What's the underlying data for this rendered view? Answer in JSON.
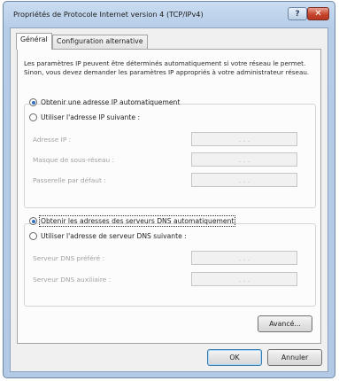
{
  "window": {
    "title": "Propriétés de Protocole Internet version 4 (TCP/IPv4)",
    "help_label": "?",
    "close_label": "✕"
  },
  "tabs": [
    {
      "label": "Général",
      "active": true
    },
    {
      "label": "Configuration alternative",
      "active": false
    }
  ],
  "general": {
    "description": "Les paramètres IP peuvent être déterminés automatiquement si votre réseau le permet. Sinon, vous devez demander les paramètres IP appropriés à votre administrateur réseau.",
    "ip_auto_label": "Obtenir une adresse IP automatiquement",
    "ip_manual_label": "Utiliser l'adresse IP suivante :",
    "ip_fields": [
      {
        "label": "Adresse IP :",
        "value": ". . ."
      },
      {
        "label": "Masque de sous-réseau :",
        "value": ". . ."
      },
      {
        "label": "Passerelle par défaut :",
        "value": ". . ."
      }
    ],
    "dns_auto_label": "Obtenir les adresses des serveurs DNS automatiquement",
    "dns_manual_label": "Utiliser l'adresse de serveur DNS suivante :",
    "dns_fields": [
      {
        "label": "Serveur DNS préféré :",
        "value": ". . ."
      },
      {
        "label": "Serveur DNS auxiliaire :",
        "value": ". . ."
      }
    ],
    "advanced_label": "Avancé..."
  },
  "buttons": {
    "ok_label": "OK",
    "cancel_label": "Annuler"
  }
}
